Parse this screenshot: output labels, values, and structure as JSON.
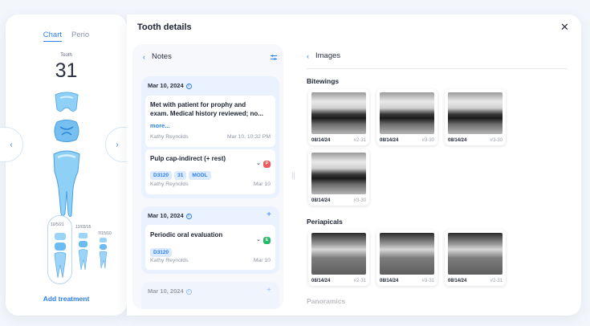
{
  "tooth_panel": {
    "tabs": [
      "Chart",
      "Perio"
    ],
    "tooth_label": "Tooth",
    "tooth_number": "31",
    "history_dates": [
      "10/5/21",
      "12/03/15",
      "7/15/10"
    ],
    "add_treatment": "Add treatment"
  },
  "modal": {
    "title": "Tooth details",
    "close_icon": "close-icon"
  },
  "notes": {
    "header": "Notes",
    "groups": [
      {
        "date": "Mar 10, 2024",
        "items": [
          {
            "text_line1": "Met with patient for prophy and",
            "text_line2": "exam. Medical history reviewed; no...",
            "more": "more...",
            "author": "Kathy Reynolds",
            "timestamp": "Mar 10, 10:32 PM"
          },
          {
            "title": "Pulp cap-indirect (+ rest)",
            "badge": "P",
            "badge_color": "#ef5b5b",
            "chips": [
              "D3120",
              "31",
              "MODL"
            ],
            "author": "Kathy Reynolds",
            "timestamp": "Mar 10"
          }
        ]
      },
      {
        "date": "Mar 10, 2024",
        "items": [
          {
            "title": "Periodic oral evaluation",
            "badge": "E",
            "badge_color": "#27b86a",
            "chips": [
              "D3120"
            ],
            "author": "Kathy Reynolds",
            "timestamp": "Mar 10"
          }
        ]
      },
      {
        "date": "Mar 10, 2024"
      }
    ]
  },
  "images": {
    "header": "Images",
    "sections": [
      {
        "title": "Bitewings",
        "items": [
          {
            "date": "08/14/24",
            "teeth": "#2-31"
          },
          {
            "date": "08/14/24",
            "teeth": "#3-30"
          },
          {
            "date": "08/14/24",
            "teeth": "#3-30"
          },
          {
            "date": "08/14/24",
            "teeth": "#3-30"
          }
        ]
      },
      {
        "title": "Periapicals",
        "items": [
          {
            "date": "08/14/24",
            "teeth": "#2-31"
          },
          {
            "date": "08/14/24",
            "teeth": "#3-31"
          },
          {
            "date": "08/14/24",
            "teeth": "#2-31"
          }
        ]
      },
      {
        "title": "Panoramics"
      }
    ]
  },
  "colors": {
    "accent": "#2b7ff2",
    "tooth": "#7cc4f3"
  }
}
